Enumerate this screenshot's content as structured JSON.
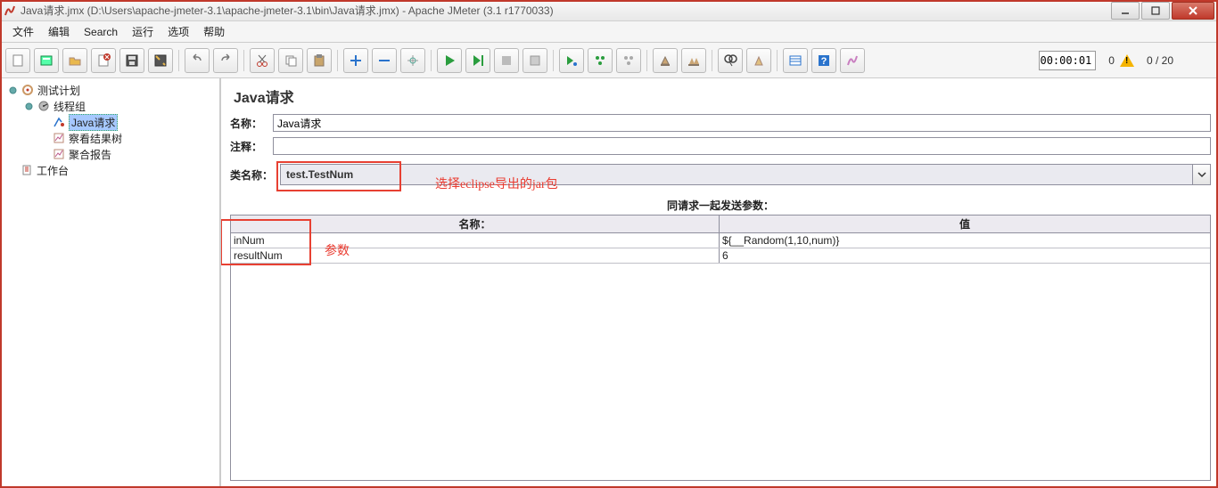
{
  "title": "Java请求.jmx (D:\\Users\\apache-jmeter-3.1\\apache-jmeter-3.1\\bin\\Java请求.jmx) - Apache JMeter (3.1 r1770033)",
  "menu": {
    "file": "文件",
    "edit": "编辑",
    "search": "Search",
    "run": "运行",
    "options": "选项",
    "help": "帮助"
  },
  "timer": "00:00:01",
  "counter1": "0",
  "counter2": "0 / 20",
  "tree": {
    "root": "测试计划",
    "threadGroup": "线程组",
    "javaRequest": "Java请求",
    "viewResults": "察看结果树",
    "aggregate": "聚合报告",
    "workbench": "工作台"
  },
  "panel": {
    "heading": "Java请求",
    "nameLabel": "名称：",
    "nameValue": "Java请求",
    "commentLabel": "注释：",
    "classLabel": "类名称：",
    "classValue": "test.TestNum"
  },
  "annotations": {
    "jar": "选择eclipse导出的jar包",
    "params": "参数"
  },
  "params": {
    "header": "同请求一起发送参数：",
    "colName": "名称：",
    "colValue": "值",
    "rows": [
      {
        "name": "inNum",
        "value": "${__Random(1,10,num)}"
      },
      {
        "name": "resultNum",
        "value": "6"
      }
    ]
  }
}
